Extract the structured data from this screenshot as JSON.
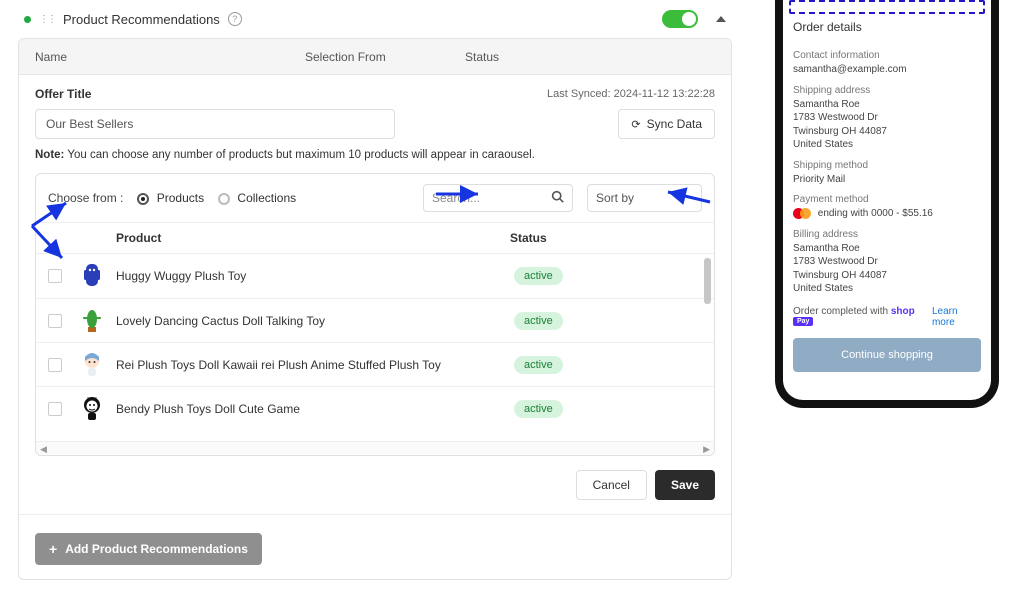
{
  "header": {
    "title": "Product Recommendations"
  },
  "columns": {
    "name": "Name",
    "selection_from": "Selection From",
    "status": "Status"
  },
  "offer": {
    "title_label": "Offer Title",
    "title_value": "Our Best Sellers",
    "last_synced": "Last Synced: 2024-11-12 13:22:28",
    "sync_label": "Sync Data",
    "note_prefix": "Note:",
    "note_body": "You can choose any number of products but maximum 10 products will appear in caraousel."
  },
  "choose": {
    "label": "Choose from :",
    "opt_products": "Products",
    "opt_collections": "Collections",
    "search_placeholder": "Search...",
    "sort_label": "Sort by"
  },
  "table": {
    "product_label": "Product",
    "status_label": "Status"
  },
  "products": [
    {
      "name": "Huggy Wuggy Plush Toy",
      "status": "active",
      "thumb": "blue-plush"
    },
    {
      "name": "Lovely Dancing Cactus Doll Talking Toy",
      "status": "active",
      "thumb": "cactus-pot"
    },
    {
      "name": "Rei Plush Toys Doll Kawaii rei Plush Anime Stuffed Plush Toy",
      "status": "active",
      "thumb": "blue-hair"
    },
    {
      "name": "Bendy Plush Toys Doll Cute Game",
      "status": "active",
      "thumb": "bendy"
    }
  ],
  "buttons": {
    "cancel": "Cancel",
    "save": "Save",
    "add": "Add Product Recommendations"
  },
  "phone": {
    "order_details": "Order details",
    "contact_label": "Contact information",
    "contact_value": "samantha@example.com",
    "ship_addr_label": "Shipping address",
    "name": "Samantha Roe",
    "addr1": "1783 Westwood Dr",
    "addr2": "Twinsburg OH 44087",
    "country": "United States",
    "ship_method_label": "Shipping method",
    "ship_method_value": "Priority Mail",
    "pay_method_label": "Payment method",
    "pay_method_value": "ending with 0000 - $55.16",
    "bill_addr_label": "Billing address",
    "order_completed": "Order completed with",
    "shop_label": "shop",
    "pay_label": "Pay",
    "learn_more": "Learn more",
    "continue": "Continue shopping"
  }
}
